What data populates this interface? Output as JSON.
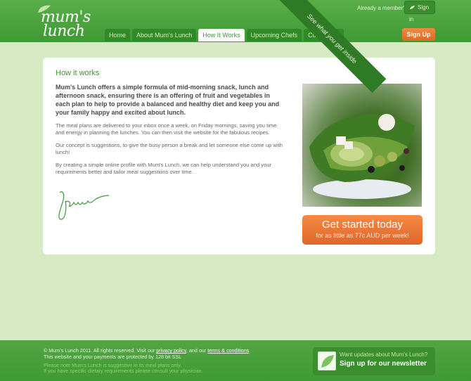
{
  "header": {
    "logo_line1": "mum's",
    "logo_line2": "lunch",
    "member_text": "Already a member?",
    "signin_label": "Sign in",
    "signup_label": "Sign Up",
    "nav": [
      {
        "label": "Home",
        "active": false
      },
      {
        "label": "About Mum's Lunch",
        "active": false
      },
      {
        "label": "How It Works",
        "active": true
      },
      {
        "label": "Upcoming Chefs",
        "active": false
      },
      {
        "label": "Contact Us",
        "active": false
      }
    ]
  },
  "main": {
    "heading": "How it works",
    "lead": "Mum's Lunch offers a simple formula of mid-morning snack, lunch and afternoon snack, ensuring there is an offering of fruit and vegetables in each plan to help to provide a balanced and healthy diet and keep you and your family happy and excited about lunch.",
    "paragraph1": "The meal plans are delivered to your inbox once a week, on Friday mornings, saving you time and energy in planning the lunches. You can then visit the website for the fabulous recipes.",
    "paragraph2": "Our concept is suggestions, to give the busy person a break and let someone else come up with lunch!",
    "paragraph3": "By creating a simple online profile with Mum's Lunch, we can help understand you and your requirements better and tailor meal suggestions over time.",
    "ribbon_text": "See what you get inside",
    "cta_title": "Get started today",
    "cta_subtitle": "for as little as 77c AUD per week!"
  },
  "footer": {
    "line1_prefix": "© Mum's Lunch 2011. All rights reserved. Visit our",
    "privacy_link": "privacy policy",
    "line1_middle": ", and our",
    "terms_link": "terms & conditions",
    "line2": "This website and your payments are protected by 128 bit SSL",
    "line3": "Please note Mum's Lunch is suggestive in its meal plans only.",
    "line4": "If you have specific dietary requirements please consult your physician.",
    "newsletter_title": "Want updates about Mum's Lunch?",
    "newsletter_cta": "Sign up for our newsletter"
  },
  "colors": {
    "brand_green": "#3e9a34",
    "accent_orange": "#e0662a"
  }
}
